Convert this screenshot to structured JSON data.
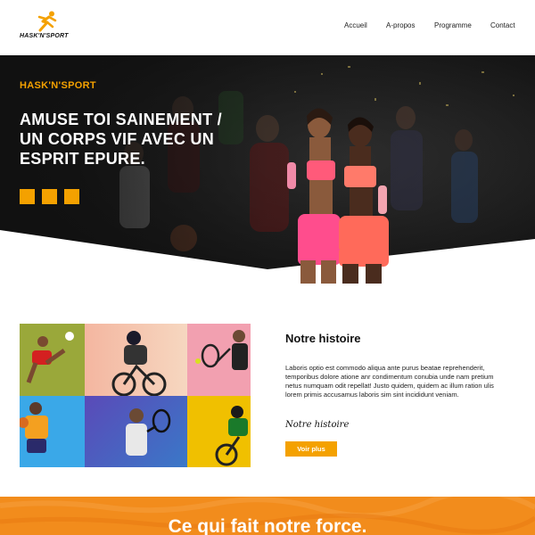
{
  "header": {
    "logo_text": "HASK'N'SPORT",
    "nav": [
      "Accueil",
      "A-propos",
      "Programme",
      "Contact"
    ]
  },
  "hero": {
    "kicker": "HASK'N'SPORT",
    "title_lines": [
      "AMUSE TOI SAINEMENT /",
      "UN CORPS VIF AVEC UN",
      "ESPRIT EPURE."
    ]
  },
  "story": {
    "title": "Notre histoire",
    "text": "Laboris optio est commodo aliqua ante purus beatae reprehenderit, temporibus dolore atione anr condimentum conubia unde nam pretium netus numquam odit repellat! Justo quidem, quidem ac illum ration ulis lorem primis accusamus laboris sim sint incididunt veniam.",
    "signature": "Notre histoire",
    "button": "Voir plus"
  },
  "band": {
    "title": "Ce qui fait notre force."
  },
  "colors": {
    "accent": "#f4a100",
    "band": "#f28c1c",
    "hero_dark": "#1c1c1c"
  },
  "icons": [
    "running-person-logo-icon"
  ]
}
